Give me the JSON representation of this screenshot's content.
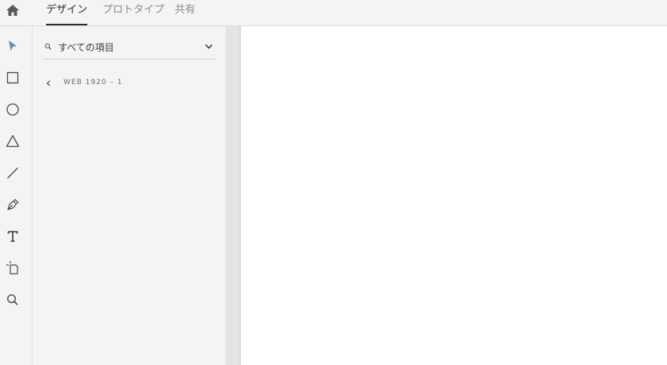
{
  "header": {
    "home_icon": "home-icon",
    "tabs": [
      {
        "label": "デザイン",
        "active": true
      },
      {
        "label": "プロトタイプ",
        "active": false
      },
      {
        "label": "共有",
        "active": false
      }
    ]
  },
  "toolbar": {
    "tools": [
      {
        "name": "select",
        "icon": "arrow-select-icon",
        "active": true
      },
      {
        "name": "rectangle",
        "icon": "rectangle-icon"
      },
      {
        "name": "ellipse",
        "icon": "ellipse-icon"
      },
      {
        "name": "polygon",
        "icon": "triangle-icon"
      },
      {
        "name": "line",
        "icon": "line-icon"
      },
      {
        "name": "pen",
        "icon": "pen-icon"
      },
      {
        "name": "text",
        "icon": "text-icon"
      },
      {
        "name": "artboard",
        "icon": "artboard-icon"
      },
      {
        "name": "zoom",
        "icon": "zoom-icon"
      }
    ],
    "active_color": "#6a8fb0"
  },
  "layers": {
    "search": {
      "placeholder": "すべての項目",
      "icon": "search-icon"
    },
    "artboard_label": "WEB 1920 – 1"
  },
  "colors": {
    "panel_bg": "#f4f4f4",
    "canvas_bg": "#ffffff",
    "tab_active": "#2c2c2c",
    "tab_inactive": "#8a8a8a"
  }
}
